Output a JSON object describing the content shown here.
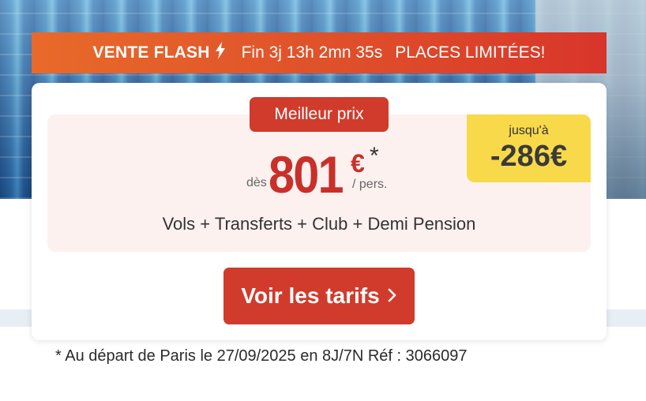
{
  "flash": {
    "title": "VENTE FLASH",
    "countdown": "Fin 3j 13h 2mn 35s",
    "limited": "PLACES LIMITÉES!"
  },
  "offer": {
    "badge": "Meilleur prix",
    "from_label": "dès",
    "price": "801",
    "currency": "€",
    "asterisk": "*",
    "per_person": "/ pers.",
    "discount_label": "jusqu'à",
    "discount_value": "-286€",
    "package": "Vols + Transferts + Club + Demi Pension",
    "cta_label": "Voir les tarifs",
    "cta_icon": "chevron-right-icon"
  },
  "footnote": "* Au départ de Paris le 27/09/2025 en 8J/7N Réf : 3066097",
  "colors": {
    "accent_red": "#d13b2c",
    "flash_orange": "#e86a2a",
    "discount_yellow": "#f8d94a",
    "price_box_bg": "#fdf1f0"
  }
}
